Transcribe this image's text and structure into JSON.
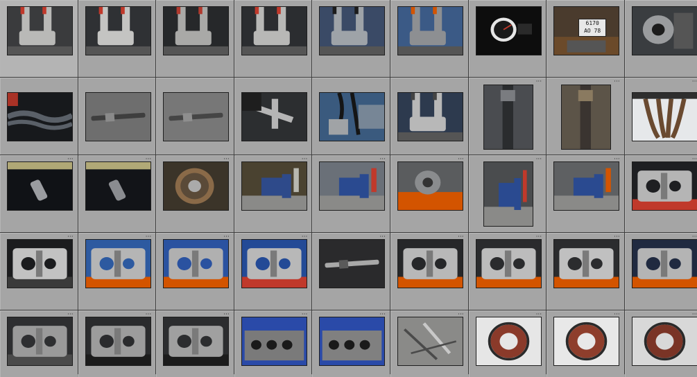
{
  "grid": {
    "columns": 9,
    "rows": 5,
    "badge_text": "···"
  },
  "plate": {
    "line1": "6170",
    "line2": "AO 78"
  },
  "thumbnails": [
    {
      "subject": "front-fork-caliper",
      "orient": "land",
      "bg": "#3a3b3d",
      "fg": "#b9b9b7",
      "accent": "#c0392b",
      "dots": false
    },
    {
      "subject": "front-fork-caliper",
      "orient": "land",
      "bg": "#2f3134",
      "fg": "#c4c4c2",
      "accent": "#c0392b",
      "dots": false
    },
    {
      "subject": "front-fork-caliper",
      "orient": "land",
      "bg": "#26282a",
      "fg": "#a9a9a7",
      "accent": "#b03a2e",
      "dots": false
    },
    {
      "subject": "caliper-closeup",
      "orient": "land",
      "bg": "#2b2d30",
      "fg": "#b8b8b6",
      "accent": "#c0392b",
      "dots": false
    },
    {
      "subject": "caliper-bracket",
      "orient": "land",
      "bg": "#3a4a66",
      "fg": "#9ea3a8",
      "accent": "#1c1c1c",
      "dots": false
    },
    {
      "subject": "forks-workshop",
      "orient": "land",
      "bg": "#3b5a86",
      "fg": "#8d8f92",
      "accent": "#d35400",
      "dots": false
    },
    {
      "subject": "speedometer",
      "orient": "land",
      "bg": "#0d0d0d",
      "fg": "#e6e6e6",
      "accent": "#c0392b",
      "dots": false
    },
    {
      "subject": "license-plate",
      "orient": "land",
      "bg": "#4a3b2d",
      "fg": "#e8e8e8",
      "accent": "#6b4a2a",
      "dots": false
    },
    {
      "subject": "rear-wheel-hub",
      "orient": "land",
      "bg": "#3a3d40",
      "fg": "#9a9c9e",
      "accent": "#1c1c1c",
      "dots": false
    },
    {
      "subject": "drive-chain",
      "orient": "land",
      "bg": "#17191c",
      "fg": "#5a6068",
      "accent": "#a93226",
      "dots": false
    },
    {
      "subject": "shaft-on-floor",
      "orient": "land",
      "bg": "#6e6e6e",
      "fg": "#3e3e3e",
      "accent": "#8a8a8a",
      "dots": false
    },
    {
      "subject": "shaft-on-floor",
      "orient": "land",
      "bg": "#777777",
      "fg": "#454545",
      "accent": "#8e8e8e",
      "dots": false
    },
    {
      "subject": "shift-linkage",
      "orient": "land",
      "bg": "#2c2e30",
      "fg": "#b5b5b5",
      "accent": "#1e1e1e",
      "dots": false
    },
    {
      "subject": "brake-lines",
      "orient": "land",
      "bg": "#3a5a7e",
      "fg": "#a0a3a6",
      "accent": "#151515",
      "dots": false
    },
    {
      "subject": "caliper-parts",
      "orient": "land",
      "bg": "#2d3a4e",
      "fg": "#b8b8b8",
      "accent": "#444",
      "dots": false
    },
    {
      "subject": "fork-tube-vertical",
      "orient": "port",
      "bg": "#4a4c50",
      "fg": "#2a2c2e",
      "accent": "#7a7c80",
      "dots": true
    },
    {
      "subject": "fork-tube-vertical",
      "orient": "port",
      "bg": "#5c5448",
      "fg": "#3a3430",
      "accent": "#8a7a60",
      "dots": true
    },
    {
      "subject": "exhaust-headers",
      "orient": "land",
      "bg": "#e6e8ea",
      "fg": "#6a4a30",
      "accent": "#2e2e2e",
      "dots": true
    },
    {
      "subject": "crank-part-dark",
      "orient": "land",
      "bg": "#101216",
      "fg": "#9a9ca0",
      "accent": "#f5e8a0",
      "dots": true
    },
    {
      "subject": "crank-part-dark",
      "orient": "land",
      "bg": "#121418",
      "fg": "#8a8c90",
      "accent": "#f5e8a0",
      "dots": true
    },
    {
      "subject": "clutch-disc",
      "orient": "land",
      "bg": "#3b3429",
      "fg": "#8a6a48",
      "accent": "#5a4a38",
      "dots": true
    },
    {
      "subject": "vise-bench",
      "orient": "land",
      "bg": "#4a4230",
      "fg": "#2e4a8a",
      "accent": "#b8b8b0",
      "dots": true
    },
    {
      "subject": "blue-vise",
      "orient": "land",
      "bg": "#6a7078",
      "fg": "#2a4a90",
      "accent": "#c0392b",
      "dots": true
    },
    {
      "subject": "bench-grinder",
      "orient": "land",
      "bg": "#5a5c5e",
      "fg": "#8a8c8e",
      "accent": "#d35400",
      "dots": true
    },
    {
      "subject": "vise-vertical",
      "orient": "port",
      "bg": "#4a4c4e",
      "fg": "#2a4a90",
      "accent": "#c0392b",
      "dots": true
    },
    {
      "subject": "vise-bench",
      "orient": "land",
      "bg": "#5e6062",
      "fg": "#2a4a90",
      "accent": "#d35400",
      "dots": true
    },
    {
      "subject": "engine-head",
      "orient": "land",
      "bg": "#1e1f22",
      "fg": "#b5b5b5",
      "accent": "#c0392b",
      "dots": true
    },
    {
      "subject": "engine-case",
      "orient": "land",
      "bg": "#1b1c1e",
      "fg": "#c2c2c2",
      "accent": "#3a3a3a",
      "dots": true
    },
    {
      "subject": "engine-case",
      "orient": "land",
      "bg": "#2d5aa0",
      "fg": "#b5b5b5",
      "accent": "#d35400",
      "dots": true
    },
    {
      "subject": "engine-case",
      "orient": "land",
      "bg": "#2a52a0",
      "fg": "#b0b0b0",
      "accent": "#d35400",
      "dots": true
    },
    {
      "subject": "engine-case",
      "orient": "land",
      "bg": "#234a96",
      "fg": "#b8b8b8",
      "accent": "#c0392b",
      "dots": true
    },
    {
      "subject": "gear-shafts",
      "orient": "land",
      "bg": "#2a2a2c",
      "fg": "#a8a8a8",
      "accent": "#5a5a5a",
      "dots": true
    },
    {
      "subject": "engine-block",
      "orient": "land",
      "bg": "#262729",
      "fg": "#b8b8b8",
      "accent": "#d35400",
      "dots": true
    },
    {
      "subject": "engine-block",
      "orient": "land",
      "bg": "#2a2b2d",
      "fg": "#bcbcbc",
      "accent": "#d35400",
      "dots": true
    },
    {
      "subject": "engine-block",
      "orient": "land",
      "bg": "#2b2c2e",
      "fg": "#c0c0c0",
      "accent": "#d35400",
      "dots": true
    },
    {
      "subject": "engine-block",
      "orient": "land",
      "bg": "#202a40",
      "fg": "#b4b4b4",
      "accent": "#d35400",
      "dots": true
    },
    {
      "subject": "cover-parts",
      "orient": "land",
      "bg": "#2e2f31",
      "fg": "#9a9a9a",
      "accent": "#4a4a4a",
      "dots": true
    },
    {
      "subject": "crankcase-half",
      "orient": "land",
      "bg": "#2a2b2d",
      "fg": "#9c9c9c",
      "accent": "#1c1c1c",
      "dots": true
    },
    {
      "subject": "crankcase-half",
      "orient": "land",
      "bg": "#2c2d2f",
      "fg": "#a0a0a0",
      "accent": "#1c1c1c",
      "dots": true
    },
    {
      "subject": "cylinder-head",
      "orient": "land",
      "bg": "#2a4aa8",
      "fg": "#7a7a7a",
      "accent": "#1a1a1a",
      "dots": true
    },
    {
      "subject": "cylinder-head",
      "orient": "land",
      "bg": "#2a4aa8",
      "fg": "#808080",
      "accent": "#1a1a1a",
      "dots": true
    },
    {
      "subject": "bolts-tools",
      "orient": "land",
      "bg": "#8a8a88",
      "fg": "#4a4a4a",
      "accent": "#c8c8c8",
      "dots": true
    },
    {
      "subject": "stator-coil",
      "orient": "land",
      "bg": "#e6e6e6",
      "fg": "#8a3a2a",
      "accent": "#2a2a2a",
      "dots": true
    },
    {
      "subject": "stator-coil",
      "orient": "land",
      "bg": "#e8e8e8",
      "fg": "#8e3e2c",
      "accent": "#2a2a2a",
      "dots": true
    },
    {
      "subject": "stator-coil",
      "orient": "land",
      "bg": "#d8d8d8",
      "fg": "#7a3426",
      "accent": "#2a2a2a",
      "dots": true
    }
  ]
}
